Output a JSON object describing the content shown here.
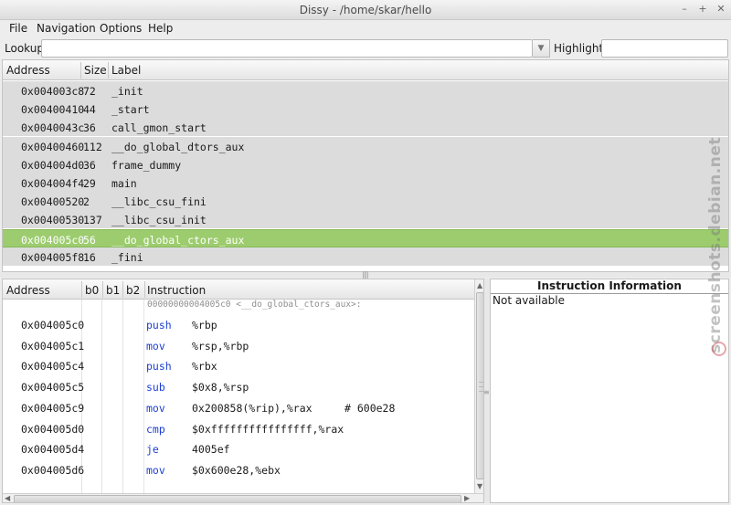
{
  "window": {
    "title": "Dissy - /home/skar/hello"
  },
  "menu": [
    "File",
    "Navigation",
    "Options",
    "Help"
  ],
  "toolbar": {
    "lookup_label": "Lookup",
    "highlight_label": "Highlight",
    "lookup_value": "",
    "highlight_value": ""
  },
  "symbols": {
    "columns": [
      "Address",
      "Size",
      "Label"
    ],
    "rows": [
      {
        "address": "0x004003c8",
        "size": "72",
        "label": "_init"
      },
      {
        "address": "0x00400410",
        "size": "44",
        "label": "_start"
      },
      {
        "address": "0x0040043c",
        "size": "36",
        "label": "call_gmon_start"
      },
      {
        "address": "0x00400460",
        "size": "112",
        "label": "__do_global_dtors_aux"
      },
      {
        "address": "0x004004d0",
        "size": "36",
        "label": "frame_dummy"
      },
      {
        "address": "0x004004f4",
        "size": "29",
        "label": "main"
      },
      {
        "address": "0x00400520",
        "size": "2",
        "label": "__libc_csu_fini"
      },
      {
        "address": "0x00400530",
        "size": "137",
        "label": "__libc_csu_init"
      },
      {
        "address": "0x004005c0",
        "size": "56",
        "label": "__do_global_ctors_aux"
      },
      {
        "address": "0x004005f8",
        "size": "16",
        "label": "_fini"
      }
    ],
    "selected_index": 8
  },
  "instructions": {
    "columns": [
      "Address",
      "b0",
      "b1",
      "b2",
      "Instruction"
    ],
    "function_header": "00000000004005c0 <__do_global_ctors_aux>:",
    "rows": [
      {
        "address": "0x004005c0",
        "mnemonic": "push",
        "operands": "%rbp",
        "comment": ""
      },
      {
        "address": "0x004005c1",
        "mnemonic": "mov",
        "operands": "%rsp,%rbp",
        "comment": ""
      },
      {
        "address": "0x004005c4",
        "mnemonic": "push",
        "operands": "%rbx",
        "comment": ""
      },
      {
        "address": "0x004005c5",
        "mnemonic": "sub",
        "operands": "$0x8,%rsp",
        "comment": ""
      },
      {
        "address": "0x004005c9",
        "mnemonic": "mov",
        "operands": "0x200858(%rip),%rax",
        "comment": "# 600e28"
      },
      {
        "address": "0x004005d0",
        "mnemonic": "cmp",
        "operands": "$0xffffffffffffffff,%rax",
        "comment": ""
      },
      {
        "address": "0x004005d4",
        "mnemonic": "je",
        "operands": "4005ef",
        "comment": ""
      },
      {
        "address": "0x004005d6",
        "mnemonic": "mov",
        "operands": "$0x600e28,%ebx",
        "comment": ""
      }
    ]
  },
  "info": {
    "title": "Instruction Information",
    "body": "Not available"
  },
  "watermark": "screenshots.debian.net",
  "colors": {
    "selection": "#9ccc6e",
    "mnemonic": "#1b3fd6"
  }
}
